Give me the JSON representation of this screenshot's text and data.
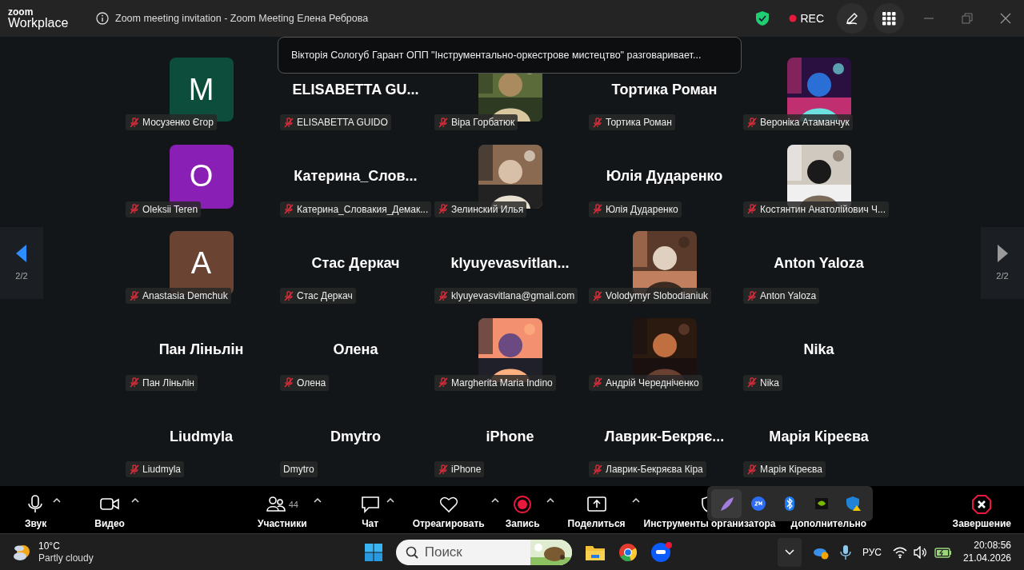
{
  "window": {
    "logo_top": "zoom",
    "logo_bottom": "Workplace",
    "title": "Zoom meeting invitation - Zoom Meeting Елена Реброва",
    "rec_label": "REC"
  },
  "notification": "Вікторія Сологуб Гарант ОПП \"Інструментально-оркестрове мистецтво\" разговаривает...",
  "pager": [
    {
      "label": "2/2",
      "active": true
    },
    {
      "label": "2/2",
      "active": false
    }
  ],
  "tiles": [
    {
      "kind": "avatar",
      "letter": "M",
      "color": "#0d4d3b",
      "label": "Мосузенко Єгор",
      "muted": true
    },
    {
      "kind": "name",
      "display": "ELISABETTA  GU...",
      "label": "ELISABETTA GUIDO",
      "muted": true
    },
    {
      "kind": "picture",
      "label": "Віра Горбатюк",
      "muted": true
    },
    {
      "kind": "name",
      "display": "Тортика Роман",
      "label": "Тортика Роман",
      "muted": true
    },
    {
      "kind": "picture",
      "label": "Вероніка Атаманчук",
      "muted": true
    },
    {
      "kind": "avatar",
      "letter": "O",
      "color": "#8a1fb5",
      "label": "Oleksii Teren",
      "muted": true
    },
    {
      "kind": "name",
      "display": "Катерина_Слов...",
      "label": "Катерина_Словакия_Демак...",
      "muted": true
    },
    {
      "kind": "picture",
      "label": "Зелинский Илья",
      "muted": true
    },
    {
      "kind": "name",
      "display": "Юлія Дударенко",
      "label": "Юлія Дударенко",
      "muted": true
    },
    {
      "kind": "picture",
      "label": "Костянтин Анатолійович Ч...",
      "muted": true
    },
    {
      "kind": "avatar",
      "letter": "A",
      "color": "#6b4333",
      "label": "Anastasia Demchuk",
      "muted": true
    },
    {
      "kind": "name",
      "display": "Стас Деркач",
      "label": "Стас Деркач",
      "muted": true
    },
    {
      "kind": "name",
      "display": "klyuyevasvitlan...",
      "label": "klyuyevasvitlana@gmail.com",
      "muted": true
    },
    {
      "kind": "picture",
      "label": "Volodymyr Slobodianiuk",
      "muted": true
    },
    {
      "kind": "name",
      "display": "Anton Yaloza",
      "label": "Anton Yaloza",
      "muted": true
    },
    {
      "kind": "name",
      "display": "Пан Ліньлін",
      "label": "Пан Ліньлін",
      "muted": true
    },
    {
      "kind": "name",
      "display": "Олена",
      "label": "Олена",
      "muted": true
    },
    {
      "kind": "picture",
      "label": "Margherita Maria Indino",
      "muted": true
    },
    {
      "kind": "picture",
      "label": "Андрій Чередніченко",
      "muted": true
    },
    {
      "kind": "name",
      "display": "Nika",
      "label": "Nika",
      "muted": true
    },
    {
      "kind": "name",
      "display": "Liudmyla",
      "label": "Liudmyla",
      "muted": true
    },
    {
      "kind": "name",
      "display": "Dmytro",
      "label": "Dmytro",
      "muted": false
    },
    {
      "kind": "name",
      "display": "iPhone",
      "label": "iPhone",
      "muted": true
    },
    {
      "kind": "name",
      "display": "Лаврик-Бекряє...",
      "label": "Лаврик-Бекряєва Кіра",
      "muted": true
    },
    {
      "kind": "name",
      "display": "Марія Кіреєва",
      "label": "Марія Кіреєва",
      "muted": true
    }
  ],
  "toolbar": [
    {
      "kind": "audio",
      "label": "Звук"
    },
    {
      "kind": "video",
      "label": "Видео"
    },
    {
      "kind": "participants",
      "label": "Участники",
      "count": "44"
    },
    {
      "kind": "chat",
      "label": "Чат"
    },
    {
      "kind": "react",
      "label": "Отреагировать"
    },
    {
      "kind": "record",
      "label": "Запись"
    },
    {
      "kind": "share",
      "label": "Поделиться"
    },
    {
      "kind": "host",
      "label": "Инструменты организатора"
    },
    {
      "kind": "more",
      "label": "Дополнительно"
    },
    {
      "kind": "end",
      "label": "Завершение"
    }
  ],
  "tray_popup": [
    {
      "kind": "feather",
      "selected": true
    },
    {
      "kind": "zoom",
      "selected": false
    },
    {
      "kind": "bluetooth",
      "selected": false
    },
    {
      "kind": "nvidia",
      "selected": false
    },
    {
      "kind": "security",
      "selected": false
    }
  ],
  "taskbar": {
    "temperature": "10°C",
    "weather": "Partly cloudy",
    "search_placeholder": "Поиск",
    "language": "РУС",
    "time": "20:08:56",
    "date": "21.04.2026"
  }
}
